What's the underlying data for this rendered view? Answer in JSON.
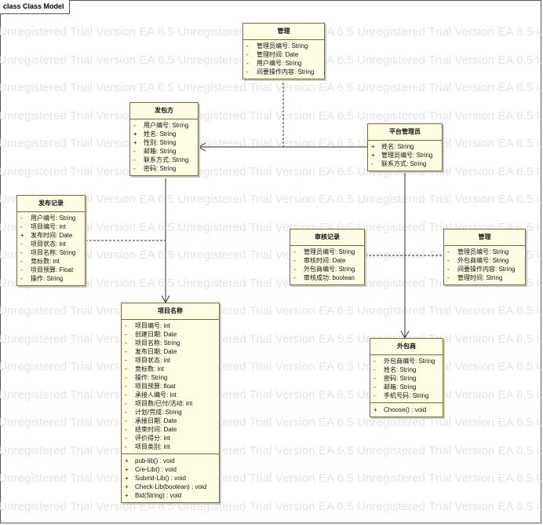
{
  "frame_title": "class Class Model",
  "watermark_text": "Unregistered Trial Version   EA 6.5 Unregistered Trial Version   EA 6.5 Unregistered Trial Version   EA 6.5 Unregistered Trial Version",
  "classes": {
    "guanli_top": {
      "title": "管理",
      "attributes": [
        {
          "vis": "-",
          "text": "管理员编号:  String"
        },
        {
          "vis": "-",
          "text": "管理时间:  Date"
        },
        {
          "vis": "-",
          "text": "用户编号:  String"
        },
        {
          "vis": "-",
          "text": "间要操作内容:  String"
        }
      ],
      "operations": []
    },
    "fabaofang": {
      "title": "发包方",
      "attributes": [
        {
          "vis": "-",
          "text": "用户编号:  String"
        },
        {
          "vis": "+",
          "text": "姓名:  String"
        },
        {
          "vis": "+",
          "text": "性别:  String"
        },
        {
          "vis": "-",
          "text": "邮箱:  String"
        },
        {
          "vis": "-",
          "text": "联系方式:  String"
        },
        {
          "vis": "-",
          "text": "密码:  String"
        }
      ],
      "operations": []
    },
    "pingtai": {
      "title": "平台管理员",
      "attributes": [
        {
          "vis": "+",
          "text": "姓名:  String"
        },
        {
          "vis": "+",
          "text": "管理员编号:  String"
        },
        {
          "vis": "-",
          "text": "联系方式:  String"
        }
      ],
      "operations": []
    },
    "fabujilu": {
      "title": "发布记录",
      "attributes": [
        {
          "vis": "-",
          "text": "用户编号:  String"
        },
        {
          "vis": "-",
          "text": "项目编号:  int"
        },
        {
          "vis": "+",
          "text": "发布时间:  Date"
        },
        {
          "vis": "-",
          "text": "项目状态:  int"
        },
        {
          "vis": "-",
          "text": "项目名称:  String"
        },
        {
          "vis": "-",
          "text": "竞标数:  int"
        },
        {
          "vis": "-",
          "text": "项目预算:  Float"
        },
        {
          "vis": "-",
          "text": "操作:  String"
        }
      ],
      "operations": []
    },
    "shenhe": {
      "title": "审核记录",
      "attributes": [
        {
          "vis": "-",
          "text": "管理员编号:  String"
        },
        {
          "vis": "-",
          "text": "审核时间:  Date"
        },
        {
          "vis": "-",
          "text": "外包商编号:  String"
        },
        {
          "vis": "-",
          "text": "审核成功:  boolean"
        }
      ],
      "operations": []
    },
    "guanli_right": {
      "title": "管理",
      "attributes": [
        {
          "vis": "-",
          "text": "管理员编号:  String"
        },
        {
          "vis": "-",
          "text": "外包商编号:  String"
        },
        {
          "vis": "-",
          "text": "间要操作内容:  String"
        },
        {
          "vis": "-",
          "text": "管理时间:  String"
        }
      ],
      "operations": []
    },
    "xiangmu": {
      "title": "项目名称",
      "attributes": [
        {
          "vis": "-",
          "text": "项目编号:  int"
        },
        {
          "vis": "-",
          "text": "创建日期:  Date"
        },
        {
          "vis": "-",
          "text": "项目名称:  String"
        },
        {
          "vis": "-",
          "text": "发布日期:  Date"
        },
        {
          "vis": "-",
          "text": "项目状态:  int"
        },
        {
          "vis": "-",
          "text": "竞标数:  int"
        },
        {
          "vis": "-",
          "text": "操作:  String"
        },
        {
          "vis": "-",
          "text": "项目预算:  float"
        },
        {
          "vis": "-",
          "text": "承接人编号:  int"
        },
        {
          "vis": "-",
          "text": "项目数/已付/活动:  int"
        },
        {
          "vis": "-",
          "text": "计划/完成:  String"
        },
        {
          "vis": "-",
          "text": "承接日期:  Date"
        },
        {
          "vis": "-",
          "text": "结束时间:  Date"
        },
        {
          "vis": "-",
          "text": "评价得分:  int"
        },
        {
          "vis": "-",
          "text": "项目类别:  int"
        }
      ],
      "operations": [
        {
          "vis": "+",
          "text": "pub-lib() : void"
        },
        {
          "vis": "+",
          "text": "Cre-Lib() : void"
        },
        {
          "vis": "+",
          "text": "Submit-Lib() : void"
        },
        {
          "vis": "+",
          "text": "Check-Lib(boolean) : void"
        },
        {
          "vis": "+",
          "text": " Bid(String) : void"
        }
      ]
    },
    "waibaoshang": {
      "title": "外包商",
      "attributes": [
        {
          "vis": "-",
          "text": "外包商编号:  String"
        },
        {
          "vis": "-",
          "text": "姓名:  String"
        },
        {
          "vis": "-",
          "text": "密码:  String"
        },
        {
          "vis": "-",
          "text": "邮箱:  String"
        },
        {
          "vis": "-",
          "text": "手机号码:  String"
        }
      ],
      "operations": [
        {
          "vis": "+",
          "text": "Choose() : void"
        }
      ]
    }
  }
}
